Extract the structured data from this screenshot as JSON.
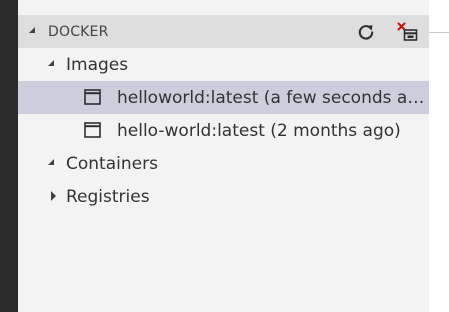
{
  "explorer": {
    "section": {
      "title": "DOCKER",
      "actions": [
        {
          "name": "refresh",
          "icon": "refresh-icon"
        },
        {
          "name": "remove-window",
          "icon": "remove-window-icon"
        }
      ]
    },
    "tree": {
      "images": {
        "label": "Images",
        "expanded": true,
        "items": [
          {
            "label": "helloworld:latest (a few seconds ago)",
            "icon": "window-icon",
            "selected": true
          },
          {
            "label": "hello-world:latest (2 months ago)",
            "icon": "window-icon",
            "selected": false
          }
        ]
      },
      "containers": {
        "label": "Containers",
        "expanded": true
      },
      "registries": {
        "label": "Registries",
        "expanded": false
      }
    }
  },
  "colors": {
    "sidebar_bg": "#f3f3f3",
    "header_bg": "#dedede",
    "selection_bg": "#cccedb",
    "activity_bar_bg": "#2c2c2c",
    "text": "#333333",
    "remove_accent": "#c5140d"
  }
}
